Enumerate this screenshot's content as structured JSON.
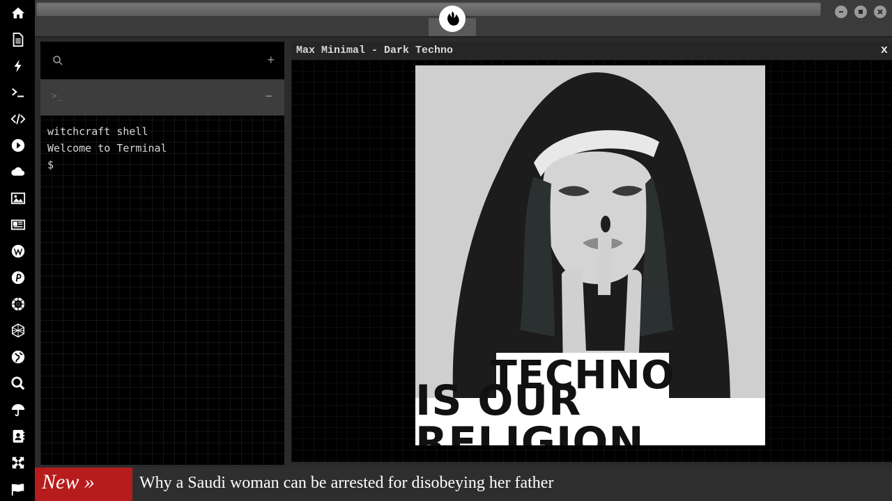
{
  "sidebar": {
    "items": [
      {
        "icon": "home-icon"
      },
      {
        "icon": "document-icon"
      },
      {
        "icon": "lightning-icon"
      },
      {
        "icon": "terminal-icon"
      },
      {
        "icon": "code-icon"
      },
      {
        "icon": "play-icon"
      },
      {
        "icon": "cloud-icon"
      },
      {
        "icon": "image-icon"
      },
      {
        "icon": "newspaper-icon"
      },
      {
        "icon": "wordpress-icon"
      },
      {
        "icon": "pinterest-icon"
      },
      {
        "icon": "empire-icon"
      },
      {
        "icon": "sphere-icon"
      },
      {
        "icon": "globe-icon"
      },
      {
        "icon": "search-icon"
      },
      {
        "icon": "umbrella-icon"
      },
      {
        "icon": "contact-book-icon"
      },
      {
        "icon": "expand-icon"
      },
      {
        "icon": "flag-icon"
      }
    ]
  },
  "window_controls": {
    "minimize": "minimize-icon",
    "maximize": "maximize-icon",
    "close": "close-icon"
  },
  "terminal": {
    "add_label": "+",
    "tab_prompt": ">_",
    "tab_minus": "−",
    "lines": [
      "witchcraft shell",
      "Welcome to Terminal",
      "$"
    ]
  },
  "player": {
    "title": "Max Minimal - Dark Techno",
    "close_label": "x",
    "poster": {
      "line1": "TECHNO",
      "line2": "IS OUR RELIGION"
    }
  },
  "ticker": {
    "badge": "New »",
    "headline": "Why a Saudi woman can be arrested for disobeying her father"
  },
  "colors": {
    "sidebar_bg": "#000000",
    "ticker_badge": "#b71c1c",
    "chrome": "#3b3b3b"
  }
}
